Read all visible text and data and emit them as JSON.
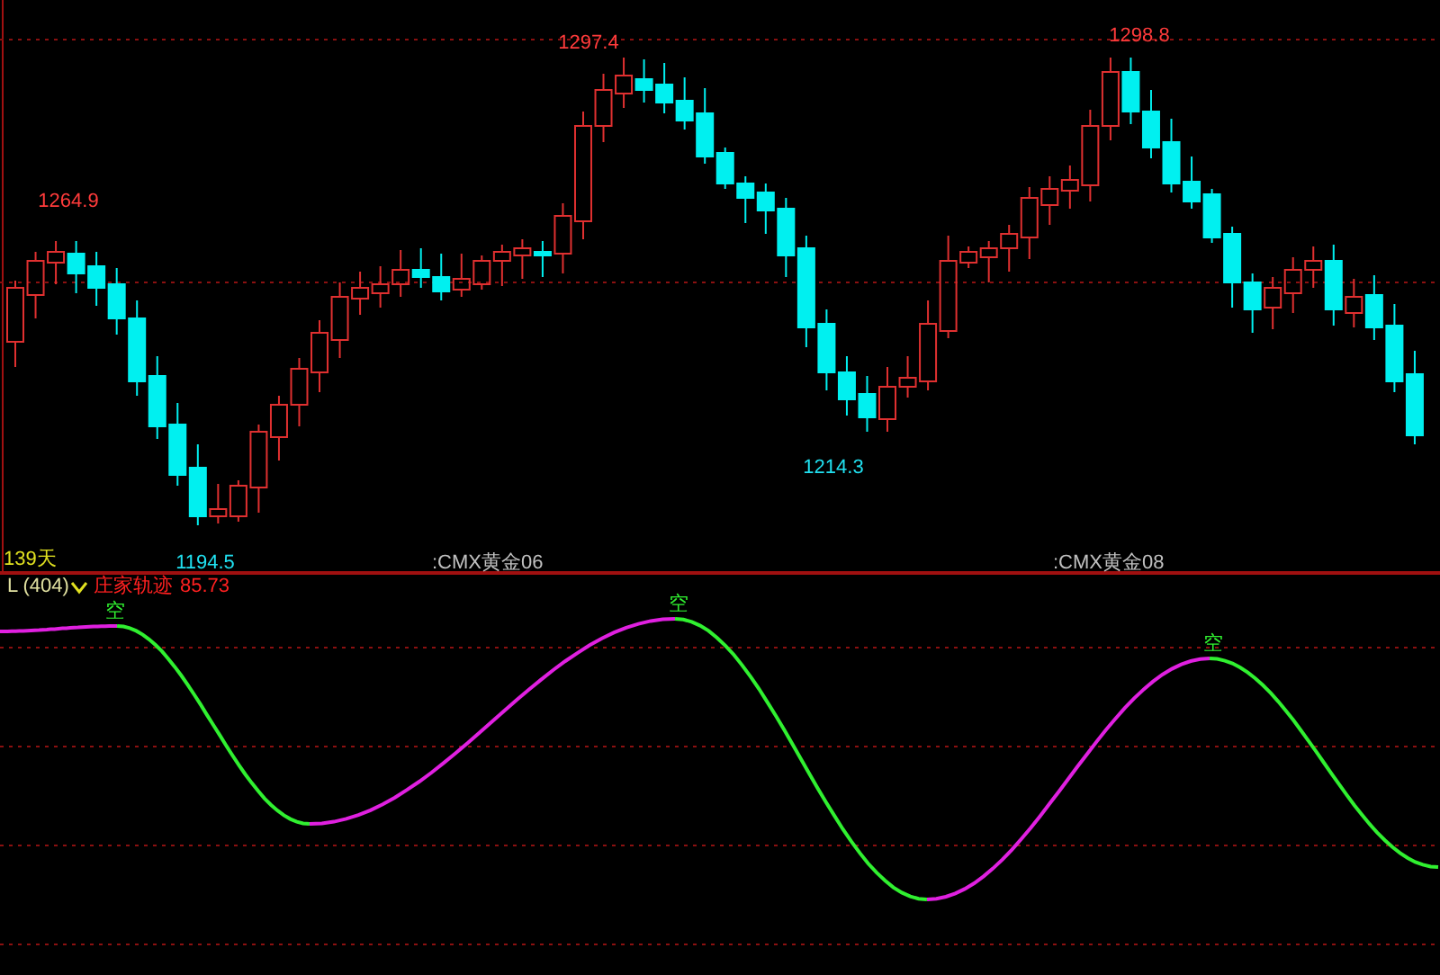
{
  "price_panel": {
    "annotations": [
      {
        "text": "1264.9",
        "kind": "high"
      },
      {
        "text": "1297.4",
        "kind": "high"
      },
      {
        "text": "1298.8",
        "kind": "high"
      },
      {
        "text": "1194.5",
        "kind": "low"
      },
      {
        "text": "1214.3",
        "kind": "low"
      }
    ],
    "period_label": "139天",
    "contract_labels": [
      ":CMX黄金06",
      ":CMX黄金08"
    ]
  },
  "indicator_panel": {
    "name": "L (404)",
    "title": "庄家轨迹",
    "value": "85.73",
    "signals": [
      "空",
      "空",
      "空"
    ]
  }
}
